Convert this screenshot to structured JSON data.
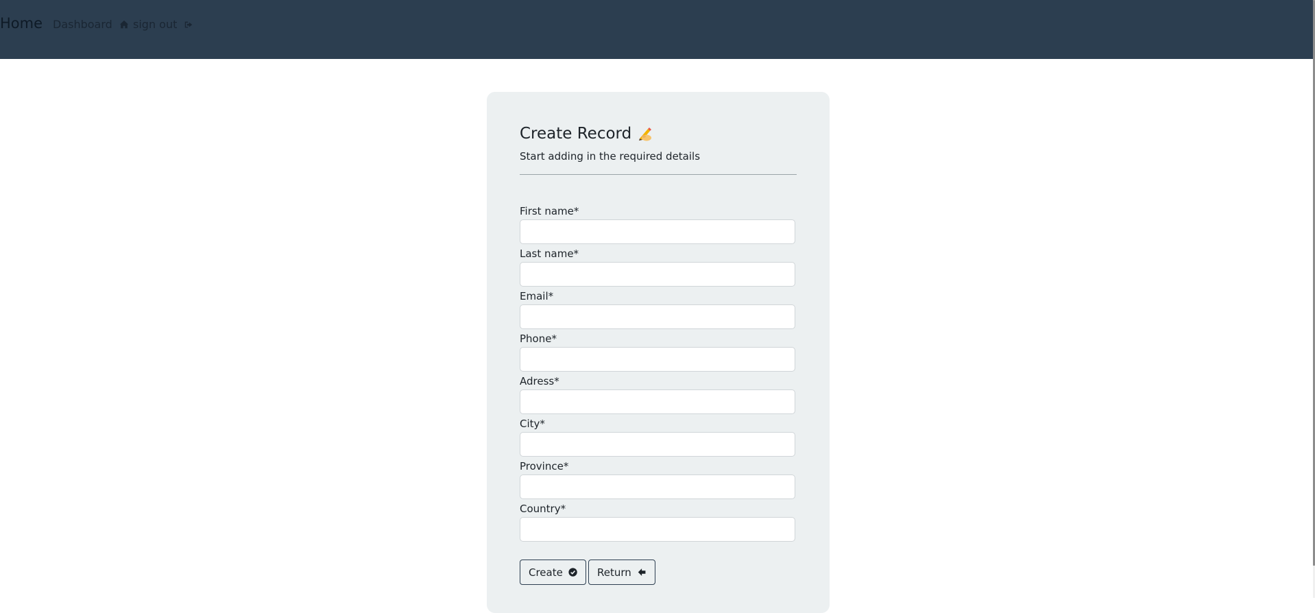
{
  "navbar": {
    "brand": "Home",
    "links": [
      {
        "label": "Dashboard",
        "icon": "home-icon"
      },
      {
        "label": "sign out",
        "icon": "sign-out-icon"
      }
    ],
    "background": "#2c3e50"
  },
  "form": {
    "title": "Create Record",
    "title_icon": "writing-hand-icon",
    "subtitle": "Start adding in the required details",
    "fields": [
      {
        "label": "First name*",
        "value": ""
      },
      {
        "label": "Last name*",
        "value": ""
      },
      {
        "label": "Email*",
        "value": ""
      },
      {
        "label": "Phone*",
        "value": ""
      },
      {
        "label": "Adress*",
        "value": ""
      },
      {
        "label": "City*",
        "value": ""
      },
      {
        "label": "Province*",
        "value": ""
      },
      {
        "label": "Country*",
        "value": ""
      }
    ],
    "buttons": {
      "create": {
        "label": "Create",
        "icon": "check-circle-icon"
      },
      "return": {
        "label": "Return",
        "icon": "arrow-left-icon"
      }
    },
    "card_background": "#ecf0f1"
  }
}
